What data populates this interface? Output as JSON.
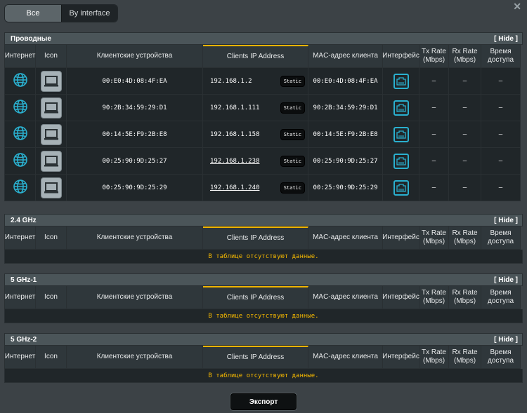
{
  "tabs": {
    "all": "Все",
    "by_interface": "By interface"
  },
  "columns": [
    "Интернет",
    "Icon",
    "Клиентские устройства",
    "Clients IP Address",
    "MAC-адрес клиента",
    "Интерфейс",
    "Tx Rate (Mbps)",
    "Rx Rate (Mbps)",
    "Время доступа"
  ],
  "hide_label": "[ Hide ]",
  "empty_message": "В таблице отсутствуют данные.",
  "static_label": "Static",
  "sections": {
    "wired": {
      "title": "Проводные",
      "rows": [
        {
          "device": "00:E0:4D:08:4F:EA",
          "ip": "192.168.1.2",
          "mac": "00:E0:4D:08:4F:EA",
          "tx": "–",
          "rx": "–",
          "time": "–"
        },
        {
          "device": "90:2B:34:59:29:D1",
          "ip": "192.168.1.111",
          "mac": "90:2B:34:59:29:D1",
          "tx": "–",
          "rx": "–",
          "time": "–"
        },
        {
          "device": "00:14:5E:F9:2B:E8",
          "ip": "192.168.1.158",
          "mac": "00:14:5E:F9:2B:E8",
          "tx": "–",
          "rx": "–",
          "time": "–"
        },
        {
          "device": "00:25:90:9D:25:27",
          "ip": "192.168.1.238",
          "mac": "00:25:90:9D:25:27",
          "tx": "–",
          "rx": "–",
          "time": "–"
        },
        {
          "device": "00:25:90:9D:25:29",
          "ip": "192.168.1.240",
          "mac": "00:25:90:9D:25:29",
          "tx": "–",
          "rx": "–",
          "time": "–"
        }
      ]
    },
    "g24": {
      "title": "2.4 GHz"
    },
    "g5_1": {
      "title": "5 GHz-1"
    },
    "g5_2": {
      "title": "5 GHz-2"
    }
  },
  "export_label": "Экспорт",
  "icons": {
    "internet": "globe-icon",
    "device": "laptop-icon",
    "interface": "ethernet-icon",
    "close": "close-icon"
  },
  "colors": {
    "accent": "#f0b400",
    "globe": "#2ab0cf",
    "empty_text": "#f5b800"
  }
}
